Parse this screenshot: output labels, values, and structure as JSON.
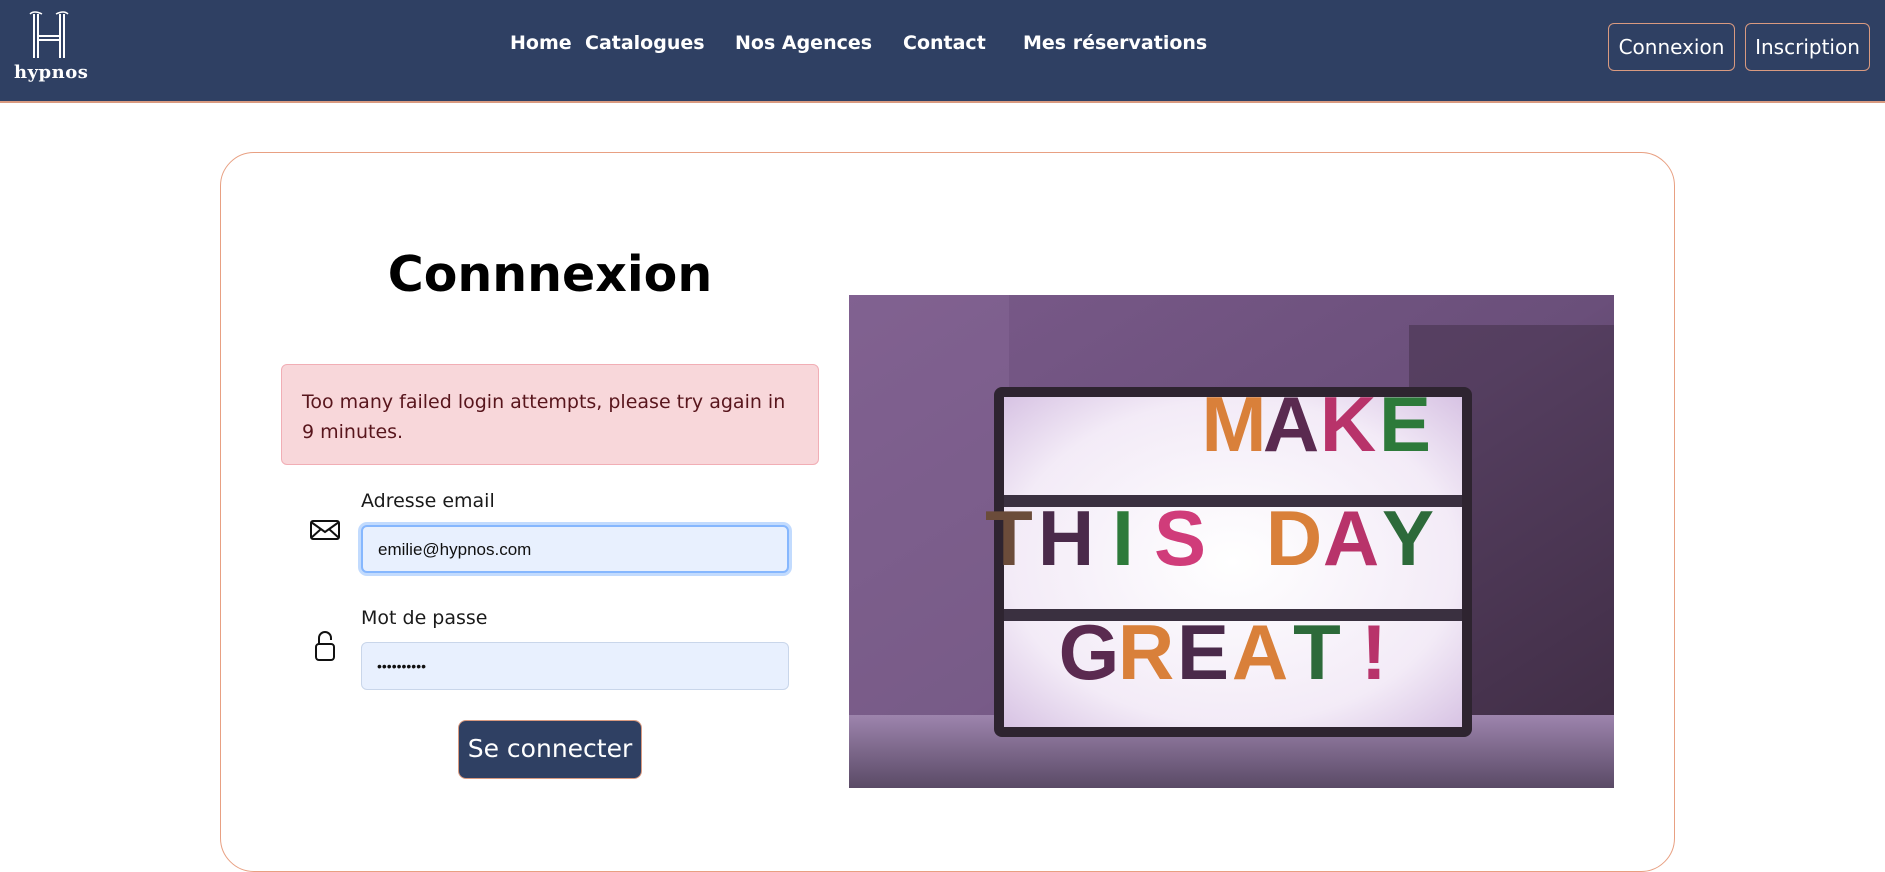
{
  "brand": {
    "name": "hypnos",
    "logo_letter": "H",
    "color_navbar": "#2f4063",
    "color_accent": "#d99a80"
  },
  "nav": {
    "links": [
      "Home",
      "Catalogues",
      "Nos Agences",
      "Contact",
      "Mes réservations"
    ],
    "login_button": "Connexion",
    "signup_button": "Inscription"
  },
  "login": {
    "title": "Connnexion",
    "alert": "Too many failed login attempts, please try again in 9 minutes.",
    "email_label": "Adresse email",
    "email_value": "emilie@hypnos.com",
    "password_label": "Mot de passe",
    "password_value": "••••••••••",
    "submit_label": "Se connecter",
    "email_icon": "envelope-icon",
    "password_icon": "lock-icon"
  },
  "photo": {
    "lightbox_lines": [
      [
        "M",
        "A",
        "K",
        "E"
      ],
      [
        "T",
        "H",
        "I",
        "S",
        " ",
        "D",
        "A",
        "Y"
      ],
      [
        "G",
        "R",
        "E",
        "A",
        "T",
        "!"
      ]
    ],
    "letter_colors": [
      [
        "#d9803a",
        "#5a2a50",
        "#b8336a",
        "#2d7a3a"
      ],
      [
        "#6b4c3a",
        "#4a2a4a",
        "#2d7a3a",
        "#d03c7a",
        "",
        "#d9803a",
        "#b8336a",
        "#2d6a3a"
      ],
      [
        "#5a2a50",
        "#d9803a",
        "#4a2a4a",
        "#d9803a",
        "#2d6a3a",
        "#b8336a"
      ]
    ]
  }
}
